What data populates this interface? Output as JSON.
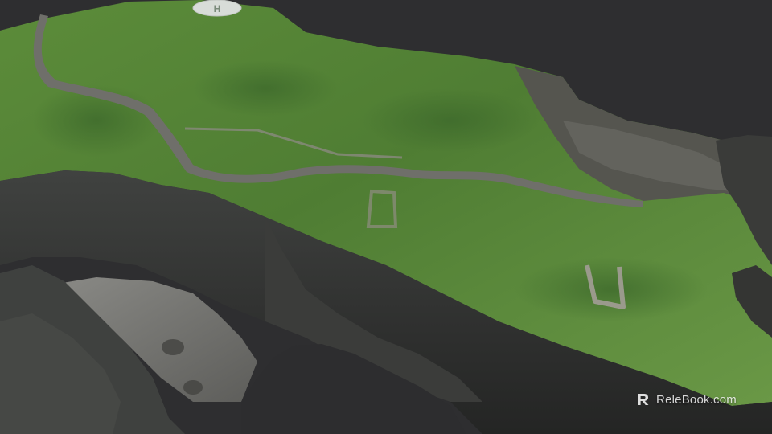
{
  "scene": {
    "background_color": "#2e2e30",
    "grass_color": "#5a8a3a",
    "rock_color": "#3a3a38",
    "stream_color": "#6f6f6a"
  },
  "helipad": {
    "letter": "H",
    "icon": "helipad-icon"
  },
  "watermark": {
    "text": "ReleBook.com",
    "icon": "relebook-logo-icon"
  }
}
